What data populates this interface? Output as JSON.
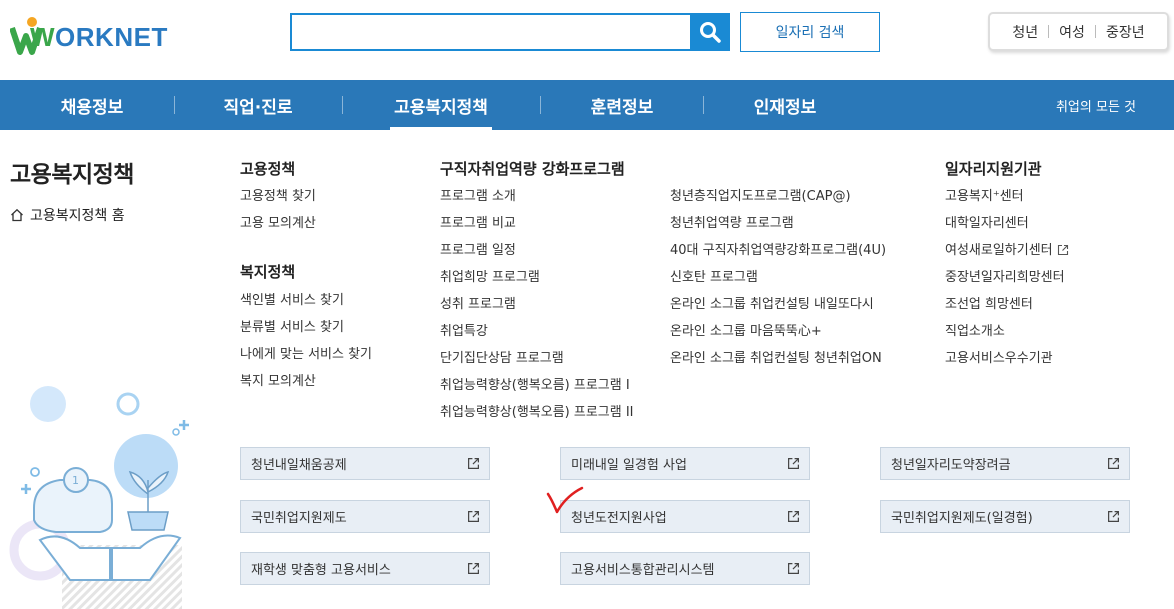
{
  "logo": {
    "text_w": "W",
    "text_rest": "ORKNET"
  },
  "search": {
    "placeholder": "",
    "value": ""
  },
  "header": {
    "job_search_button": "일자리 검색"
  },
  "quick_links": [
    "청년",
    "여성",
    "중장년"
  ],
  "nav": {
    "items": [
      "채용정보",
      "직업·진로",
      "고용복지정책",
      "훈련정보",
      "인재정보"
    ],
    "active": "고용복지정책",
    "all_jobs_link": "취업의 모든 것"
  },
  "section": {
    "title": "고용복지정책",
    "home_link": "고용복지정책 홈"
  },
  "employment_policy": {
    "title": "고용정책",
    "items": [
      "고용정책 찾기",
      "고용 모의계산"
    ]
  },
  "welfare_policy": {
    "title": "복지정책",
    "items": [
      "색인별 서비스 찾기",
      "분류별 서비스 찾기",
      "나에게 맞는 서비스 찾기",
      "복지 모의계산"
    ]
  },
  "job_seeker_programs": {
    "title": "구직자취업역량 강화프로그램",
    "col1": [
      "프로그램 소개",
      "프로그램 비교",
      "프로그램 일정",
      "취업희망 프로그램",
      "성취 프로그램",
      "취업특강",
      "단기집단상담 프로그램",
      "취업능력향상(행복오름) 프로그램 I",
      "취업능력향상(행복오름) 프로그램 II"
    ],
    "col2": [
      "청년층직업지도프로그램(CAP@)",
      "청년취업역량 프로그램",
      "40대 구직자취업역량강화프로그램(4U)",
      "신호탄 프로그램",
      "온라인 소그룹 취업컨설팅 내일또다시",
      "온라인 소그룹 마음뚝뚝心+",
      "온라인 소그룹 취업컨설팅 청년취업ON"
    ]
  },
  "job_support_orgs": {
    "title": "일자리지원기관",
    "items": [
      "고용복지⁺센터",
      "대학일자리센터",
      "여성새로일하기센터",
      "중장년일자리희망센터",
      "조선업 희망센터",
      "직업소개소",
      "고용서비스우수기관"
    ]
  },
  "box_links": {
    "col1": [
      "청년내일채움공제",
      "국민취업지원제도",
      "재학생 맞춤형 고용서비스"
    ],
    "col2": [
      "미래내일 일경험 사업",
      "청년도전지원사업",
      "고용서비스통합관리시스템"
    ],
    "col3": [
      "청년일자리도약장려금",
      "국민취업지원제도(일경험)"
    ]
  },
  "icons": [
    "search-icon",
    "home-icon",
    "external-link-icon",
    "checkmark-annotation"
  ],
  "colors": {
    "brand_blue": "#2a78b8",
    "search_blue": "#1a8ad4",
    "logo_green": "#3aa64a",
    "box_bg": "#e8eef5",
    "check_red": "#e02020"
  }
}
